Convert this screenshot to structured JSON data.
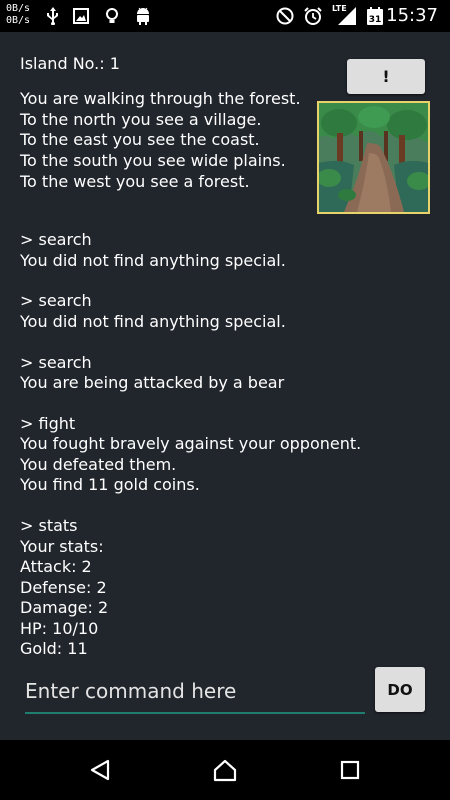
{
  "status_bar": {
    "net_up": "0B/s",
    "net_down": "0B/s",
    "network_type": "LTE",
    "calendar_day": "31",
    "time": "15:37",
    "icons": [
      "usb-icon",
      "image-icon",
      "bulb-icon",
      "android-icon",
      "do-not-disturb-icon",
      "alarm-icon",
      "signal-icon",
      "calendar-icon"
    ]
  },
  "game": {
    "island_label": "Island No.: 1",
    "hint_button": "!",
    "location_lines": [
      "You are walking through the forest.",
      "To the north you see a village.",
      "To the east you see the coast.",
      "To the south you see wide plains.",
      "To the west you see a forest."
    ],
    "log": [
      {
        "command": "> search",
        "lines": [
          "You did not find anything special."
        ]
      },
      {
        "command": "> search",
        "lines": [
          "You did not find anything special."
        ]
      },
      {
        "command": "> search",
        "lines": [
          "You are being attacked by a bear"
        ]
      },
      {
        "command": "> fight",
        "lines": [
          "You fought bravely against your opponent.",
          "You defeated them.",
          "You find 11 gold coins."
        ]
      },
      {
        "command": "> stats",
        "lines": [
          "Your stats:",
          "Attack: 2",
          "Defense: 2",
          "Damage: 2",
          "HP: 10/10",
          "Gold: 11"
        ]
      }
    ]
  },
  "command_bar": {
    "placeholder": "Enter command here",
    "value": "",
    "do_label": "DO"
  },
  "colors": {
    "app_background": "#21252c",
    "input_underline": "#1f7e70",
    "image_border": "#e8d36b",
    "button_background": "#dedede"
  },
  "nav_bar": {
    "buttons": [
      "back-icon",
      "home-icon",
      "recents-icon"
    ]
  }
}
